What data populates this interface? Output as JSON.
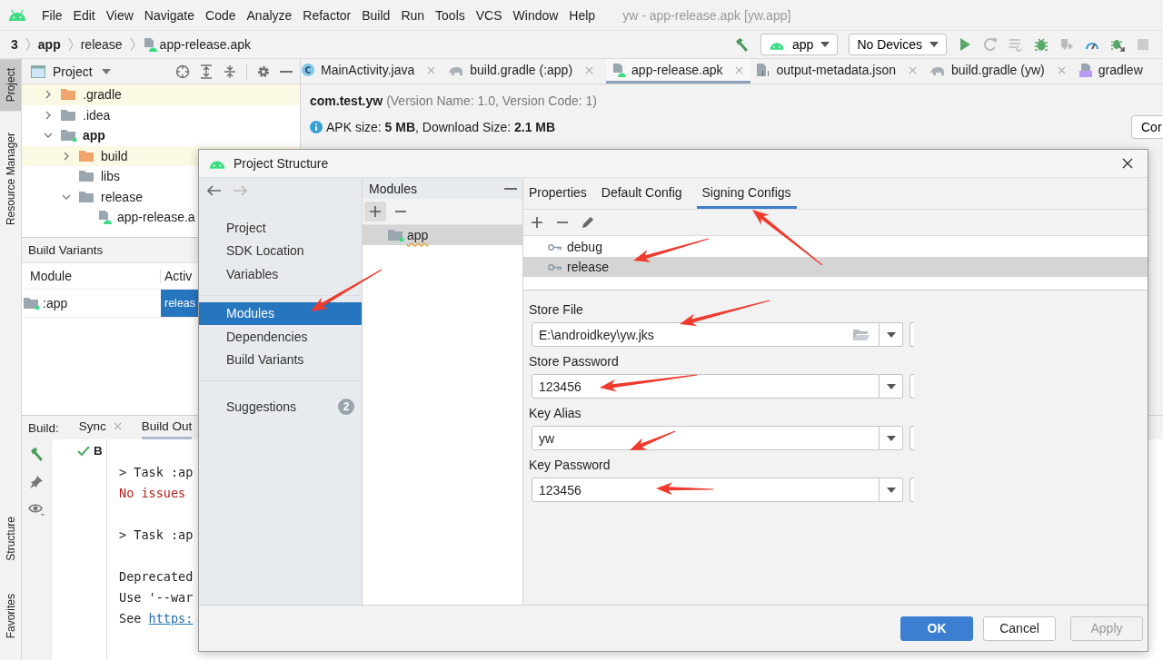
{
  "menubar": {
    "items": [
      "File",
      "Edit",
      "View",
      "Navigate",
      "Code",
      "Analyze",
      "Refactor",
      "Build",
      "Run",
      "Tools",
      "VCS",
      "Window",
      "Help"
    ],
    "title": "yw - app-release.apk [yw.app]"
  },
  "breadcrumbs": [
    {
      "label": "3",
      "kind": "project"
    },
    {
      "label": "app",
      "kind": "module"
    },
    {
      "label": "release",
      "kind": "folder"
    },
    {
      "label": "app-release.apk",
      "kind": "apk"
    }
  ],
  "run_toolbar": {
    "configuration": "app",
    "device": "No Devices"
  },
  "side_stripe": {
    "top": [
      {
        "label": "Project",
        "selected": true
      },
      {
        "label": "Resource Manager",
        "selected": false
      }
    ],
    "bottom": [
      {
        "label": "Structure",
        "selected": false
      },
      {
        "label": "Favorites",
        "selected": false
      }
    ]
  },
  "project_panel": {
    "title": "Project",
    "tree": [
      {
        "label": ".gradle",
        "kind": "excluded",
        "expanded": false,
        "highlighted": true
      },
      {
        "label": ".idea",
        "kind": "folder",
        "expanded": false,
        "highlighted": false
      },
      {
        "label": "app",
        "kind": "module",
        "expanded": true,
        "highlighted": false,
        "children": [
          {
            "label": "build",
            "kind": "excluded",
            "expanded": false,
            "highlighted": true
          },
          {
            "label": "libs",
            "kind": "folder",
            "highlighted": false
          },
          {
            "label": "release",
            "kind": "folder",
            "expanded": true,
            "highlighted": false,
            "children": [
              {
                "label": "app-release.a",
                "kind": "apk",
                "highlighted": false
              }
            ]
          }
        ]
      }
    ]
  },
  "build_variants": {
    "title": "Build Variants",
    "columns": [
      "Module",
      "Activ"
    ],
    "rows": [
      {
        "module": ":app",
        "variant": "releas",
        "selected": true
      }
    ]
  },
  "editor_tabs": [
    {
      "label": "MainActivity.java",
      "kind": "java",
      "selected": false,
      "closable": true
    },
    {
      "label": "build.gradle (:app)",
      "kind": "gradle",
      "selected": false,
      "closable": true
    },
    {
      "label": "app-release.apk",
      "kind": "apk",
      "selected": true,
      "closable": true
    },
    {
      "label": "output-metadata.json",
      "kind": "json",
      "selected": false,
      "closable": true
    },
    {
      "label": "build.gradle (yw)",
      "kind": "gradle",
      "selected": false,
      "closable": true
    },
    {
      "label": "gradlew",
      "kind": "cpp",
      "selected": false,
      "closable": false
    }
  ],
  "apk_info": {
    "package": "com.test.yw",
    "version": "(Version Name: 1.0, Version Code: 1)",
    "size": "APK size: **5 MB**, Download Size: **2.1 MB**",
    "compare_button": "Cor"
  },
  "build_panel": {
    "label": "Build:",
    "tabs": [
      {
        "label": "Sync",
        "selected": false,
        "closable": true
      },
      {
        "label": "Build Out",
        "selected": true,
        "closable": false
      }
    ],
    "tree": [
      {
        "label": "B"
      }
    ],
    "console": [
      {
        "lines": [
          {
            "text": "> Task :ap",
            "kind": "plain"
          },
          {
            "text": "No issues",
            "kind": "warning"
          }
        ]
      },
      {
        "lines": [
          {
            "text": "> Task :ap",
            "kind": "plain"
          }
        ]
      },
      {
        "lines": [
          {
            "text": "Deprecated",
            "kind": "plain"
          },
          {
            "text": "Use '--war",
            "kind": "plain"
          },
          {
            "text": "See",
            "kind": "plain",
            "link": "https:"
          }
        ]
      }
    ]
  },
  "dialog": {
    "title": "Project Structure",
    "nav": [
      [
        {
          "label": "Project",
          "selected": false
        },
        {
          "label": "SDK Location",
          "selected": false
        },
        {
          "label": "Variables",
          "selected": false
        }
      ],
      [
        {
          "label": "Modules",
          "selected": true
        },
        {
          "label": "Dependencies",
          "selected": false
        },
        {
          "label": "Build Variants",
          "selected": false
        }
      ],
      [
        {
          "label": "Suggestions",
          "selected": false,
          "badge": "2"
        }
      ]
    ],
    "modules": {
      "title": "Modules",
      "items": [
        {
          "label": "app",
          "selected": true,
          "warning": true
        }
      ]
    },
    "tabs": [
      {
        "label": "Properties",
        "selected": false
      },
      {
        "label": "Default Config",
        "selected": false
      },
      {
        "label": "Signing Configs",
        "selected": true
      }
    ],
    "configs": [
      {
        "label": "debug",
        "selected": false
      },
      {
        "label": "release",
        "selected": true
      }
    ],
    "fields": [
      {
        "label": "Store File",
        "value": "E:\\androidkey\\yw.jks",
        "kind": "file"
      },
      {
        "label": "Store Password",
        "value": "123456",
        "kind": "text"
      },
      {
        "label": "Key Alias",
        "value": "yw",
        "kind": "text"
      },
      {
        "label": "Key Password",
        "value": "123456",
        "kind": "text"
      }
    ],
    "buttons": [
      {
        "label": "OK",
        "kind": "primary",
        "disabled": false
      },
      {
        "label": "Cancel",
        "kind": "normal",
        "disabled": false
      },
      {
        "label": "Apply",
        "kind": "normal",
        "disabled": true
      }
    ]
  }
}
